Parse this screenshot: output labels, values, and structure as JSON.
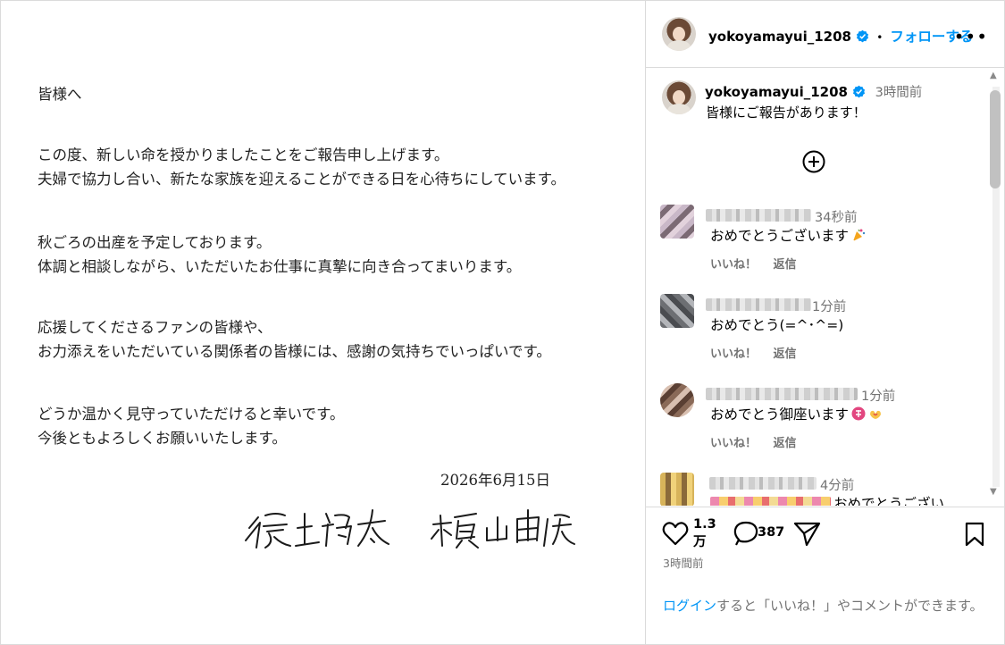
{
  "letter": {
    "greeting": "皆様へ",
    "paragraphs": [
      [
        "この度、新しい命を授かりましたことをご報告申し上げます。",
        "夫婦で協力し合い、新たな家族を迎えることができる日を心待ちにしています。"
      ],
      [
        "秋ごろの出産を予定しております。",
        "体調と相談しながら、いただいたお仕事に真摯に向き合ってまいります。"
      ],
      [
        "応援してくださるファンの皆様や、",
        "お力添えをいただいている関係者の皆様には、感謝の気持ちでいっぱいです。"
      ],
      [
        "どうか温かく見守っていただけると幸いです。",
        "今後ともよろしくお願いいたします。"
      ]
    ],
    "date": "2026年6月15日",
    "signature_1": "後上翔太",
    "signature_2": "横山由依"
  },
  "header": {
    "username": "yokoyamayui_1208",
    "separator": "•",
    "follow_label": "フォローする",
    "more_label": "•••"
  },
  "caption": {
    "username": "yokoyamayui_1208",
    "time": "3時間前",
    "text": "皆様にご報告があります！"
  },
  "comments": [
    {
      "time": "34秒前",
      "text": "おめでとうございます",
      "like_label": "いいね！",
      "reply_label": "返信",
      "emoji": "party-popper-icon"
    },
    {
      "time": "1分前",
      "text": "おめでとう(=^･^=)",
      "like_label": "いいね！",
      "reply_label": "返信",
      "emoji": ""
    },
    {
      "time": "1分前",
      "text": "おめでとう御座います",
      "like_label": "いいね！",
      "reply_label": "返信",
      "emoji": "congratulations-and-heart-hands-icon"
    },
    {
      "time": "4分前",
      "text": "おめでとうござい",
      "like_label": "",
      "reply_label": "",
      "emoji": ""
    }
  ],
  "actions": {
    "like_count_line1": "1.3",
    "like_count_line2": "万",
    "comment_count": "387",
    "posted": "3時間前"
  },
  "login_prompt": {
    "link": "ログイン",
    "rest": "すると「いいね！」やコメントができます。"
  },
  "colors": {
    "accent": "#0095f6",
    "muted": "#737373",
    "border": "#dbdbdb"
  }
}
